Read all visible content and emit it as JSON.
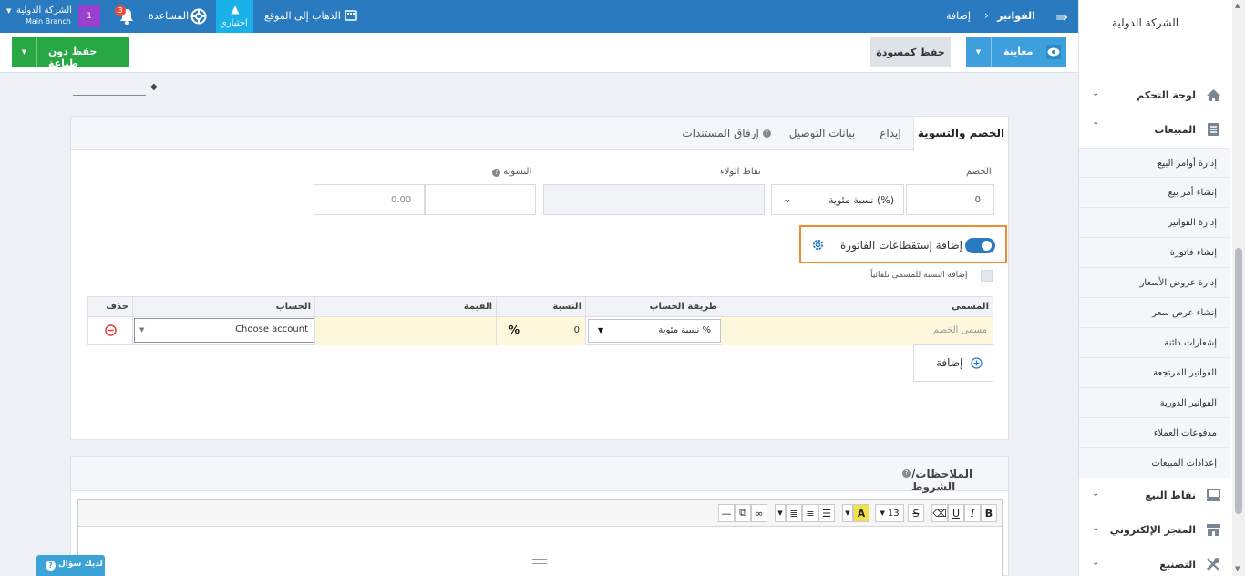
{
  "topbar": {
    "breadcrumb_parent": "الفواتير",
    "breadcrumb_current": "إضافة",
    "go_to_site": "الذهاب إلى الموقع",
    "test_mode": "اختباري",
    "help": "المساعدة",
    "notifications_count": "3",
    "branch_badge": "1",
    "company": "الشركة الدولية",
    "branch": "Main Branch"
  },
  "sidebar": {
    "company_name": "الشركة الدولية",
    "items": [
      {
        "label": "لوحة التحكم"
      },
      {
        "label": "المبيعات"
      },
      {
        "label": "نقاط البيع"
      },
      {
        "label": "المتجر الإلكتروني"
      },
      {
        "label": "التصنيع"
      }
    ],
    "sales_sub": [
      "إدارة أوامر البيع",
      "إنشاء أمر بيع",
      "إدارة الفواتير",
      "إنشاء فاتورة",
      "إدارة عروض الأسعار",
      "إنشاء عرض سعر",
      "إشعارات دائنة",
      "الفواتير المرتجعة",
      "الفواتير الدورية",
      "مدفوعات العملاء",
      "إعدادات المبيعات"
    ]
  },
  "actions": {
    "preview": "معاينة",
    "save_draft": "حفظ كمسودة",
    "save_no_print": "حفظ دون طباعة"
  },
  "tabs": {
    "discount": "الخصم والتسوية",
    "deposit": "إيداع",
    "delivery": "بيانات التوصيل",
    "attachments": "إرفاق المستندات"
  },
  "discount": {
    "discount_label": "الخصم",
    "discount_value": "0",
    "discount_type": "نسبة مئوية (%)",
    "loyalty_label": "نقاط الولاء",
    "settlement_label": "التسوية",
    "settlement_placeholder": "0.00",
    "deductions_toggle_label": "إضافة إستقطاعات الفاتورة",
    "auto_add_label": "إضافة النسبة للمسمى تلقائياً"
  },
  "deductions_table": {
    "headers": {
      "name": "المسمى",
      "calc": "طريقة الحساب",
      "rate": "النسبة",
      "value": "القيمة",
      "account": "الحساب",
      "delete": "حذف"
    },
    "row": {
      "name_placeholder": "مسمى الخصم",
      "calc": "نسبة مئوية %",
      "rate": "0",
      "rate_unit": "%",
      "account": "Choose account"
    },
    "add": "إضافة"
  },
  "notes": {
    "title": "الملاحظات/الشروط",
    "font_size": "13"
  },
  "help_float": "لديك سؤال"
}
